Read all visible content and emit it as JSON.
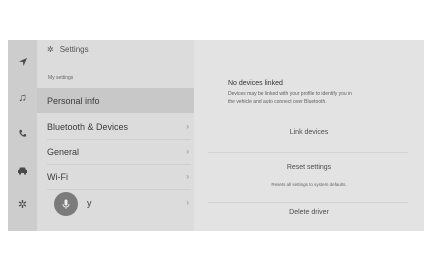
{
  "sidebar": {
    "icons": [
      "navigation-icon",
      "music-icon",
      "phone-icon",
      "car-icon",
      "gear-icon"
    ]
  },
  "header": {
    "title": "Settings"
  },
  "list": {
    "section_label": "My settings",
    "items": [
      {
        "label": "Personal info",
        "selected": true
      },
      {
        "label": "Bluetooth & Devices",
        "selected": false
      },
      {
        "label": "General",
        "selected": false
      },
      {
        "label": "Wi-Fi",
        "selected": false
      },
      {
        "label": "y",
        "selected": false
      }
    ]
  },
  "detail": {
    "title": "No devices linked",
    "description": "Devices may be linked with your profile to identify you in the vehicle and auto connect over Bluetooth.",
    "link_button": "Link devices",
    "reset_button": "Reset settings",
    "reset_note": "Resets all settings to system defaults.",
    "delete_button": "Delete driver"
  }
}
